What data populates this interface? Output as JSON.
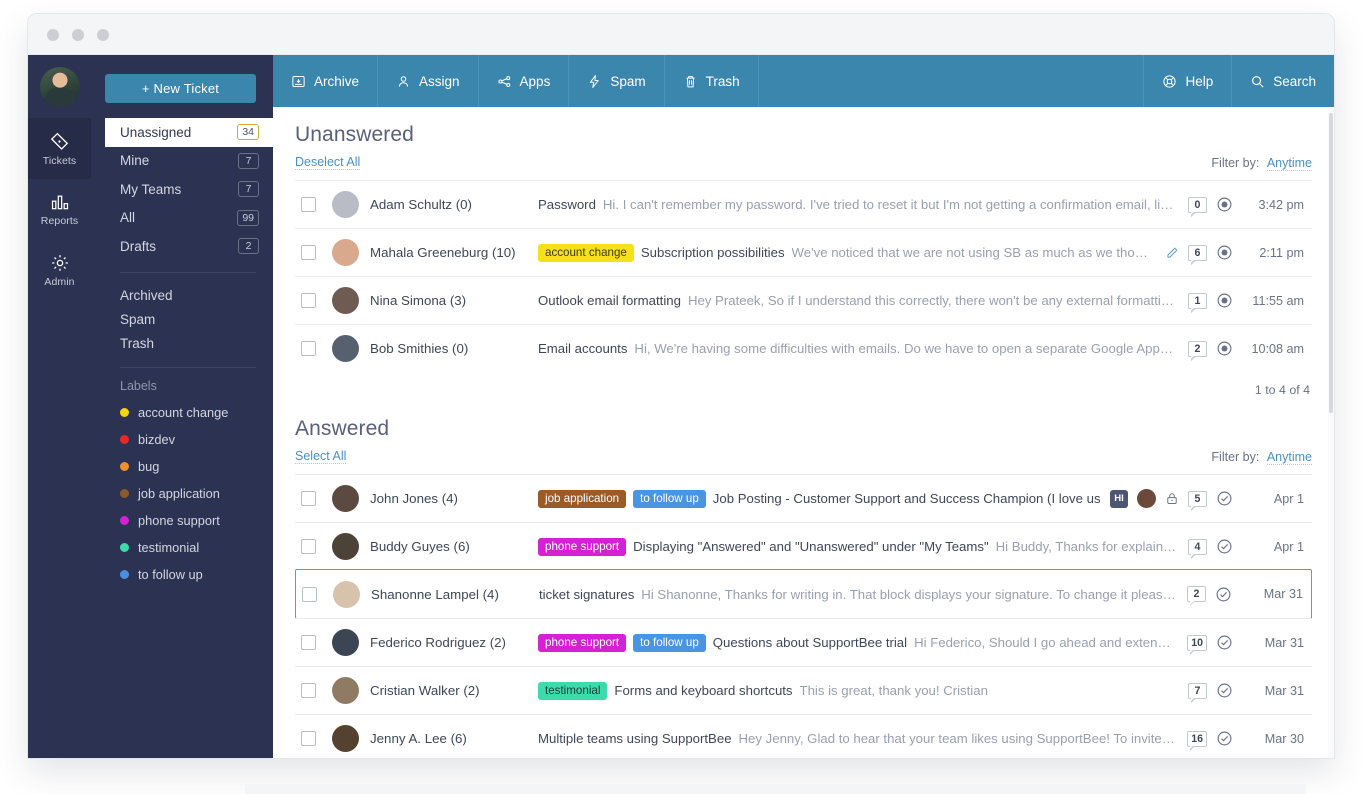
{
  "window": {
    "dots": 3
  },
  "rail": {
    "avatar": "user-avatar",
    "items": [
      {
        "label": "Tickets",
        "icon": "ticket-icon",
        "active": true
      },
      {
        "label": "Reports",
        "icon": "bar-chart-icon",
        "active": false
      },
      {
        "label": "Admin",
        "icon": "gear-icon",
        "active": false
      }
    ]
  },
  "sidebar": {
    "new_ticket_label": "+  New Ticket",
    "folders": [
      {
        "label": "Unassigned",
        "count": "34",
        "active": true
      },
      {
        "label": "Mine",
        "count": "7",
        "active": false
      },
      {
        "label": "My Teams",
        "count": "7",
        "active": false
      },
      {
        "label": "All",
        "count": "99",
        "active": false
      },
      {
        "label": "Drafts",
        "count": "2",
        "active": false
      }
    ],
    "plain_items": [
      {
        "label": "Archived"
      },
      {
        "label": "Spam"
      },
      {
        "label": "Trash"
      }
    ],
    "labels_title": "Labels",
    "labels": [
      {
        "label": "account change",
        "color": "#f5d613"
      },
      {
        "label": "bizdev",
        "color": "#ea2727"
      },
      {
        "label": "bug",
        "color": "#f0912d"
      },
      {
        "label": "job application",
        "color": "#8c5a2b"
      },
      {
        "label": "phone support",
        "color": "#d421d4"
      },
      {
        "label": "testimonial",
        "color": "#3ddbab"
      },
      {
        "label": "to follow up",
        "color": "#4a90e2"
      }
    ]
  },
  "toolbar": {
    "accent": "#3a86ad",
    "left": [
      {
        "label": "Archive",
        "icon": "archive-icon"
      },
      {
        "label": "Assign",
        "icon": "person-icon"
      },
      {
        "label": "Apps",
        "icon": "share-icon"
      },
      {
        "label": "Spam",
        "icon": "bolt-icon"
      },
      {
        "label": "Trash",
        "icon": "trash-icon"
      }
    ],
    "right": [
      {
        "label": "Help",
        "icon": "lifebuoy-icon"
      },
      {
        "label": "Search",
        "icon": "search-icon"
      }
    ]
  },
  "unanswered": {
    "title": "Unanswered",
    "select_link": "Deselect All",
    "filter_label": "Filter by:",
    "filter_value": "Anytime",
    "pager": "1 to 4 of 4",
    "rows": [
      {
        "who": "Adam Schultz (0)",
        "tags": [],
        "subject": "Password",
        "snippet": "Hi. I can't remember my password. I've tried to reset it but I'm not getting a confirmation email, like it said I...",
        "draft": false,
        "count": "0",
        "status": "unanswered",
        "time": "3:42 pm",
        "avatar": "#b9bcc4"
      },
      {
        "who": "Mahala Greeneburg (10)",
        "tags": [
          {
            "label": "account change",
            "bg": "#f5e11a",
            "fg": "#3f3b0d"
          }
        ],
        "subject": "Subscription possibilities",
        "snippet": "We've noticed that we are not using SB as much as we thought we th...",
        "draft": true,
        "count": "6",
        "status": "unanswered",
        "time": "2:11 pm",
        "avatar": "#d8a98c"
      },
      {
        "who": "Nina Simona (3)",
        "tags": [],
        "subject": "Outlook email formatting",
        "snippet": "Hey Prateek, So if I understand this correctly, there won't be any external formatting on the...",
        "draft": false,
        "count": "1",
        "status": "unanswered",
        "time": "11:55 am",
        "avatar": "#6e5b52"
      },
      {
        "who": "Bob Smithies (0)",
        "tags": [],
        "subject": "Email accounts",
        "snippet": "Hi, We're having some difficulties with emails. Do we have to open a separate Google Apps email accou...",
        "draft": false,
        "count": "2",
        "status": "unanswered",
        "time": "10:08 am",
        "avatar": "#57606e"
      }
    ]
  },
  "answered": {
    "title": "Answered",
    "select_link": "Select All",
    "filter_label": "Filter by:",
    "filter_value": "Anytime",
    "rows": [
      {
        "who": "John Jones (4)",
        "tags": [
          {
            "label": "job application",
            "bg": "#9a5b28",
            "fg": "#ffffff"
          },
          {
            "label": "to follow up",
            "bg": "#4a95e2",
            "fg": "#ffffff"
          }
        ],
        "subject": "Job Posting - Customer Support and Success Champion (I love using Su...",
        "snippet": "",
        "hi_badge": "HI",
        "assignee_avatar": "#6b4a3a",
        "locked": true,
        "count": "5",
        "status": "answered",
        "time": "Apr 1",
        "avatar": "#5c4a42",
        "selected": false
      },
      {
        "who": "Buddy Guyes (6)",
        "tags": [
          {
            "label": "phone support",
            "bg": "#d421d4",
            "fg": "#ffffff"
          }
        ],
        "subject": "Displaying  \"Answered\" and \"Unanswered\" under \"My Teams\"",
        "snippet": "Hi Buddy, Thanks for explaining! I ca...",
        "count": "4",
        "status": "answered",
        "time": "Apr 1",
        "avatar": "#4d4238",
        "selected": false
      },
      {
        "who": "Shanonne Lampel (4)",
        "tags": [],
        "subject": "ticket signatures",
        "snippet": "Hi Shanonne, Thanks for writing in. That block displays your signature. To change it please follow th...",
        "count": "2",
        "status": "answered",
        "time": "Mar 31",
        "avatar": "#d7c2ab",
        "selected": true
      },
      {
        "who": "Federico Rodriguez (2)",
        "tags": [
          {
            "label": "phone support",
            "bg": "#d421d4",
            "fg": "#ffffff"
          },
          {
            "label": "to follow up",
            "bg": "#4a95e2",
            "fg": "#ffffff"
          }
        ],
        "subject": "Questions about SupportBee trial",
        "snippet": "Hi Federico, Should I go ahead and extend your t...",
        "count": "10",
        "status": "answered",
        "time": "Mar 31",
        "avatar": "#3c4554",
        "selected": false
      },
      {
        "who": "Cristian Walker  (2)",
        "tags": [
          {
            "label": "testimonial",
            "bg": "#3ddbab",
            "fg": "#10413a"
          }
        ],
        "subject": "Forms and keyboard shortcuts",
        "snippet": "This is great, thank you! Cristian",
        "count": "7",
        "status": "answered",
        "time": "Mar 31",
        "avatar": "#8f7b63",
        "selected": false
      },
      {
        "who": "Jenny A. Lee (6)",
        "tags": [],
        "subject": "Multiple teams using SupportBee",
        "snippet": "Hey Jenny, Glad to hear that your team likes using SupportBee! To invite another de...",
        "count": "16",
        "status": "answered",
        "time": "Mar 30",
        "avatar": "#55412f",
        "selected": false
      }
    ]
  }
}
